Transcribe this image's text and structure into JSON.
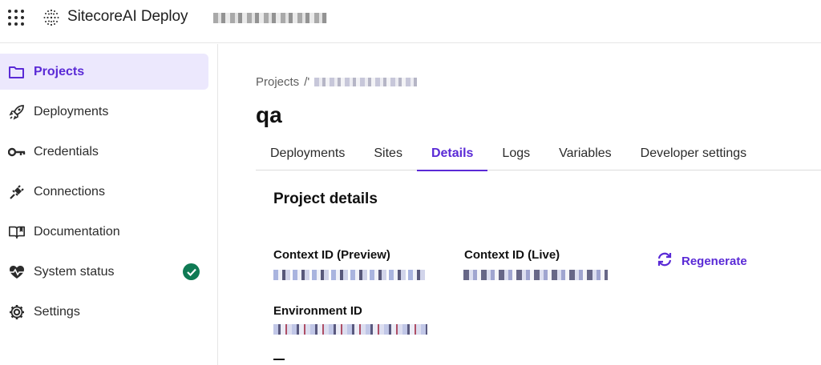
{
  "header": {
    "brand": "SitecoreAI Deploy",
    "icons": {
      "apps": "apps-grid-icon",
      "logo": "sitecore-logo-icon"
    }
  },
  "sidebar": {
    "items": [
      {
        "label": "Projects",
        "icon": "folder-icon",
        "active": true
      },
      {
        "label": "Deployments",
        "icon": "rocket-icon",
        "active": false
      },
      {
        "label": "Credentials",
        "icon": "key-icon",
        "active": false
      },
      {
        "label": "Connections",
        "icon": "plug-icon",
        "active": false
      },
      {
        "label": "Documentation",
        "icon": "book-icon",
        "active": false
      },
      {
        "label": "System status",
        "icon": "heart-pulse-icon",
        "active": false,
        "status": "check-circle-icon",
        "status_color": "#0f7a54"
      },
      {
        "label": "Settings",
        "icon": "gear-icon",
        "active": false
      }
    ]
  },
  "main": {
    "breadcrumb": {
      "root": "Projects",
      "separator": "/'"
    },
    "title": "qa",
    "tabs": [
      {
        "label": "Deployments",
        "active": false
      },
      {
        "label": "Sites",
        "active": false
      },
      {
        "label": "Details",
        "active": true
      },
      {
        "label": "Logs",
        "active": false
      },
      {
        "label": "Variables",
        "active": false
      },
      {
        "label": "Developer settings",
        "active": false
      }
    ],
    "details": {
      "section_title": "Project details",
      "context_preview_label": "Context ID (Preview)",
      "context_live_label": "Context ID (Live)",
      "environment_label": "Environment ID",
      "regenerate_label": "Regenerate"
    }
  },
  "colors": {
    "accent": "#5a2ad6",
    "active_bg": "#ece8fd",
    "status_ok": "#0f7a54"
  }
}
